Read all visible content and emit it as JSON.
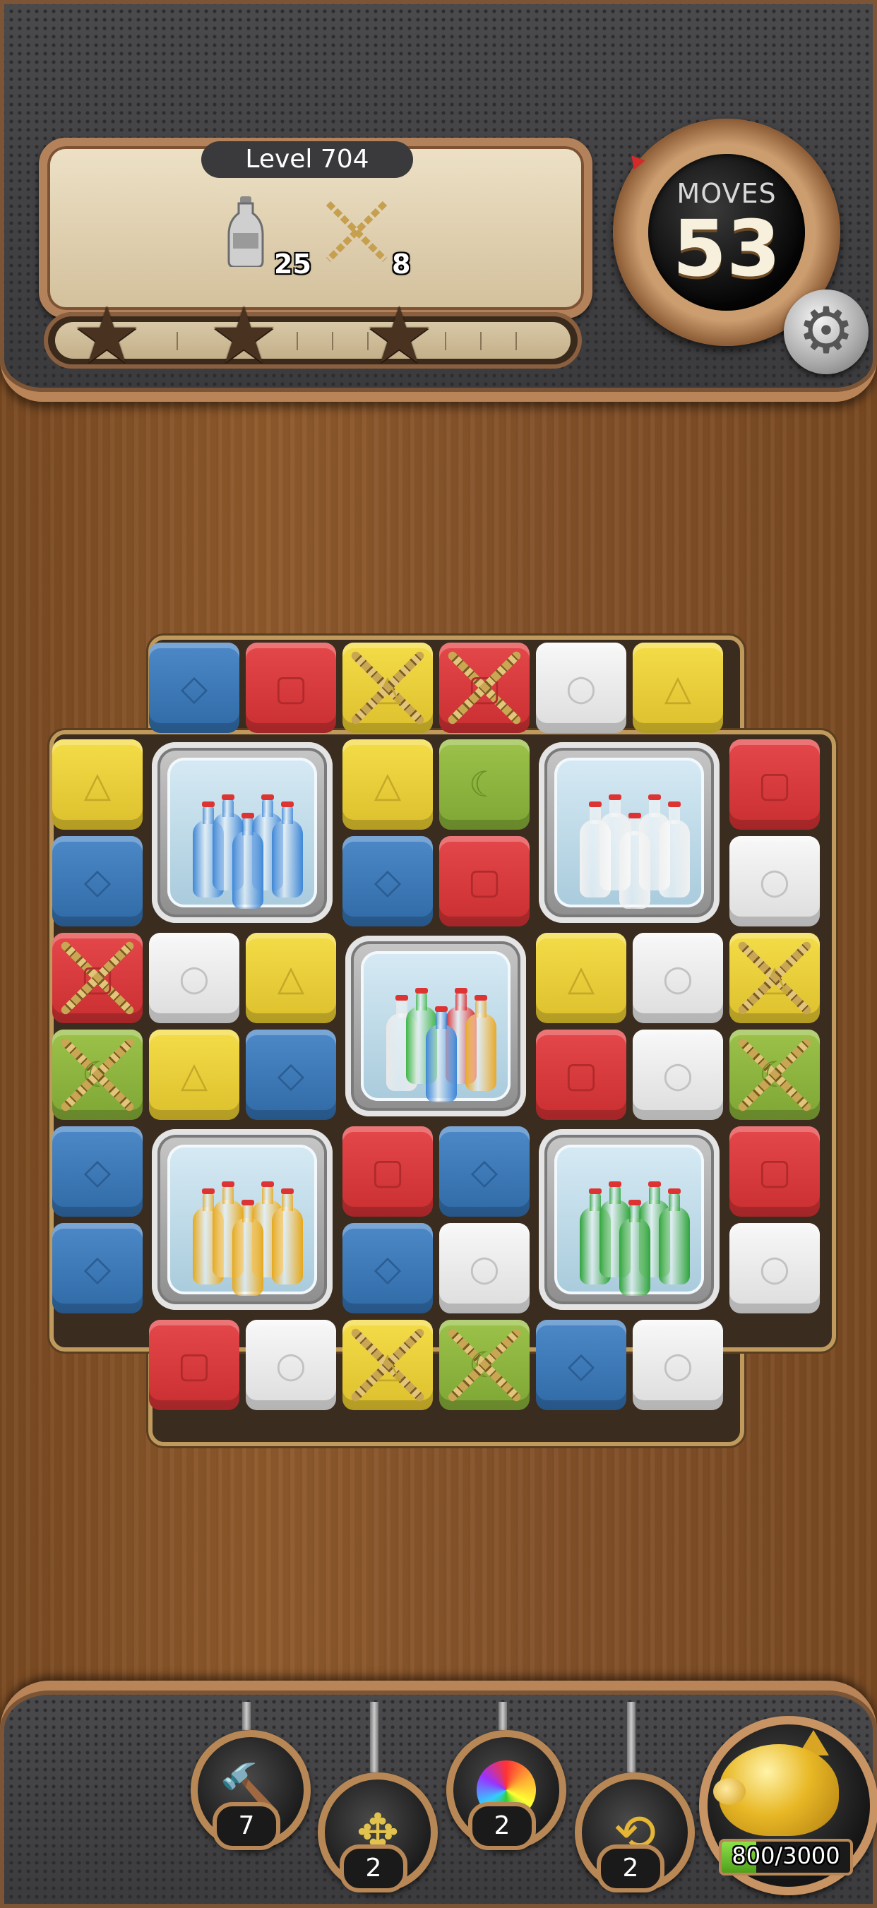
{
  "header": {
    "level_label": "Level 704",
    "goals": [
      {
        "icon": "bottle-icon",
        "count": "25"
      },
      {
        "icon": "chain-icon",
        "count": "8"
      }
    ],
    "moves_label": "MOVES",
    "moves_value": "53",
    "stars": 3,
    "progress": 0.0
  },
  "board": {
    "colors": {
      "blue": "#3f7bbd",
      "red": "#d93b3d",
      "yellow": "#eccf3a",
      "white": "#ececec",
      "green": "#8db33f"
    },
    "rows": [
      [
        "",
        "blue",
        "red",
        "yellow*",
        "red*",
        "white",
        "yellow",
        ""
      ],
      [
        "yellow",
        "BOX",
        "BOX",
        "yellow",
        "green",
        "BOX",
        "BOX",
        "red"
      ],
      [
        "blue",
        "BOX",
        "BOX",
        "blue",
        "red",
        "BOX",
        "BOX",
        "white"
      ],
      [
        "red*",
        "white",
        "yellow",
        "BOX",
        "BOX",
        "yellow",
        "white",
        "yellow*"
      ],
      [
        "green*",
        "yellow",
        "blue",
        "BOX",
        "BOX",
        "red",
        "white",
        "green*"
      ],
      [
        "blue",
        "BOX",
        "BOX",
        "red",
        "blue",
        "BOX",
        "BOX",
        "red"
      ],
      [
        "blue",
        "BOX",
        "BOX",
        "blue",
        "white",
        "BOX",
        "BOX",
        "white"
      ],
      [
        "",
        "red",
        "white",
        "yellow*",
        "green*",
        "blue",
        "white",
        ""
      ]
    ],
    "bottle_boxes": [
      {
        "row": 1,
        "col": 1,
        "bottles": "blue"
      },
      {
        "row": 1,
        "col": 5,
        "bottles": "white"
      },
      {
        "row": 3,
        "col": 3,
        "bottles": "mixed"
      },
      {
        "row": 5,
        "col": 1,
        "bottles": "yellow"
      },
      {
        "row": 5,
        "col": 5,
        "bottles": "green"
      }
    ]
  },
  "boosters": [
    {
      "name": "hammer-icon",
      "count": "7"
    },
    {
      "name": "arrows-icon",
      "count": "2"
    },
    {
      "name": "rainbow-ball-icon",
      "count": "2"
    },
    {
      "name": "shuffle-icon",
      "count": "2"
    }
  ],
  "piggy_bank": {
    "label": "800/3000",
    "fraction": 0.2667
  }
}
